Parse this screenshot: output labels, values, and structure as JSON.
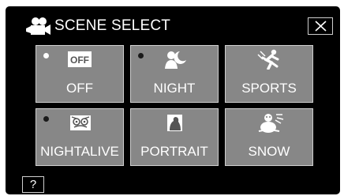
{
  "header": {
    "title": "SCENE SELECT",
    "title_icon": "movie-camera-icon",
    "close_icon": "close-icon"
  },
  "scenes": [
    {
      "label": "OFF",
      "icon": "off-badge-icon",
      "badge_text": "OFF",
      "selected": true
    },
    {
      "label": "NIGHT",
      "icon": "night-person-moon-icon",
      "selected": false
    },
    {
      "label": "SPORTS",
      "icon": "sports-runner-icon",
      "selected": false
    },
    {
      "label": "NIGHTALIVE",
      "icon": "owl-icon",
      "selected": false
    },
    {
      "label": "PORTRAIT",
      "icon": "portrait-icon",
      "selected": false
    },
    {
      "label": "SNOW",
      "icon": "snowman-icon",
      "selected": false
    }
  ],
  "help": {
    "label": "?"
  },
  "colors": {
    "screen_bg": "#000000",
    "tile_bg": "#878787",
    "tile_border": "#cfcfcf",
    "text": "#ffffff"
  }
}
